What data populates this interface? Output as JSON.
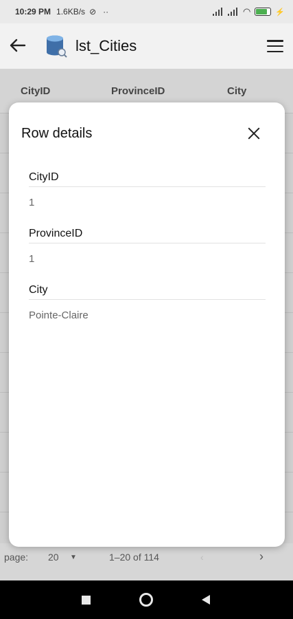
{
  "status": {
    "time": "10:29 PM",
    "speed": "1.6KB/s",
    "dots": "··"
  },
  "appbar": {
    "title": "lst_Cities"
  },
  "table": {
    "headers": [
      "CityID",
      "ProvinceID",
      "City"
    ]
  },
  "footer": {
    "rows_label": "page:",
    "rows_value": "20",
    "range": "1–20 of 114"
  },
  "dialog": {
    "title": "Row details",
    "fields": [
      {
        "label": "CityID",
        "value": "1"
      },
      {
        "label": "ProvinceID",
        "value": "1"
      },
      {
        "label": "City",
        "value": "Pointe-Claire"
      }
    ]
  }
}
